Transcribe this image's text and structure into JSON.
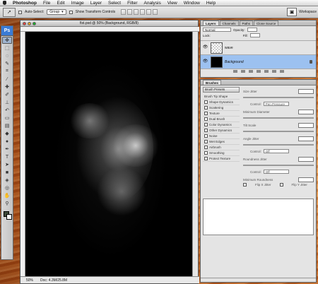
{
  "app": {
    "name": "Photoshop"
  },
  "menu": [
    "File",
    "Edit",
    "Image",
    "Layer",
    "Select",
    "Filter",
    "Analysis",
    "View",
    "Window",
    "Help"
  ],
  "options_bar": {
    "auto_select_label": "Auto-Select:",
    "auto_select_value": "Group",
    "transform_label": "Show Transform Controls",
    "workspace_label": "Workspace"
  },
  "toolbox": {
    "header": "Ps",
    "tools": [
      "move-tool",
      "marquee-tool",
      "lasso-tool",
      "quick-select-tool",
      "crop-tool",
      "eyedropper-tool",
      "healing-tool",
      "brush-tool",
      "clone-stamp-tool",
      "history-brush-tool",
      "eraser-tool",
      "gradient-tool",
      "blur-tool",
      "dodge-tool",
      "pen-tool",
      "type-tool",
      "path-select-tool",
      "shape-tool",
      "3d-tool",
      "3d-camera-tool",
      "hand-tool",
      "zoom-tool"
    ]
  },
  "document": {
    "title": "fist.psd @ 50% (Background, RGB/8)",
    "zoom": "50%",
    "doc_info": "Doc: 4.3M/25.8M"
  },
  "layers_panel": {
    "tabs": [
      "Layers",
      "Channels",
      "Paths",
      "Clone Source"
    ],
    "blend_mode": "Normal",
    "opacity_label": "Opacity:",
    "lock_label": "Lock:",
    "fill_label": "Fill:",
    "layers": [
      {
        "name": "wave",
        "selected": false
      },
      {
        "name": "Background",
        "selected": true
      }
    ]
  },
  "brushes_panel": {
    "tab": "Brushes",
    "presets_label": "Brush Presets",
    "left_items": [
      "Brush Tip Shape",
      "Shape Dynamics",
      "Scattering",
      "Texture",
      "Dual Brush",
      "Color Dynamics",
      "Other Dynamics",
      "Noise",
      "Wet Edges",
      "Airbrush",
      "Smoothing",
      "Protect Texture"
    ],
    "right": {
      "size_jitter": "Size Jitter",
      "control_label": "Control:",
      "control_value": "Pen Pressure",
      "min_diameter": "Minimum Diameter",
      "tilt_scale": "Tilt Scale",
      "angle_jitter": "Angle Jitter",
      "control2_value": "Off",
      "roundness_jitter": "Roundness Jitter",
      "control3_value": "Off",
      "min_roundness": "Minimum Roundness",
      "flip_x": "Flip X Jitter",
      "flip_y": "Flip Y Jitter"
    }
  }
}
